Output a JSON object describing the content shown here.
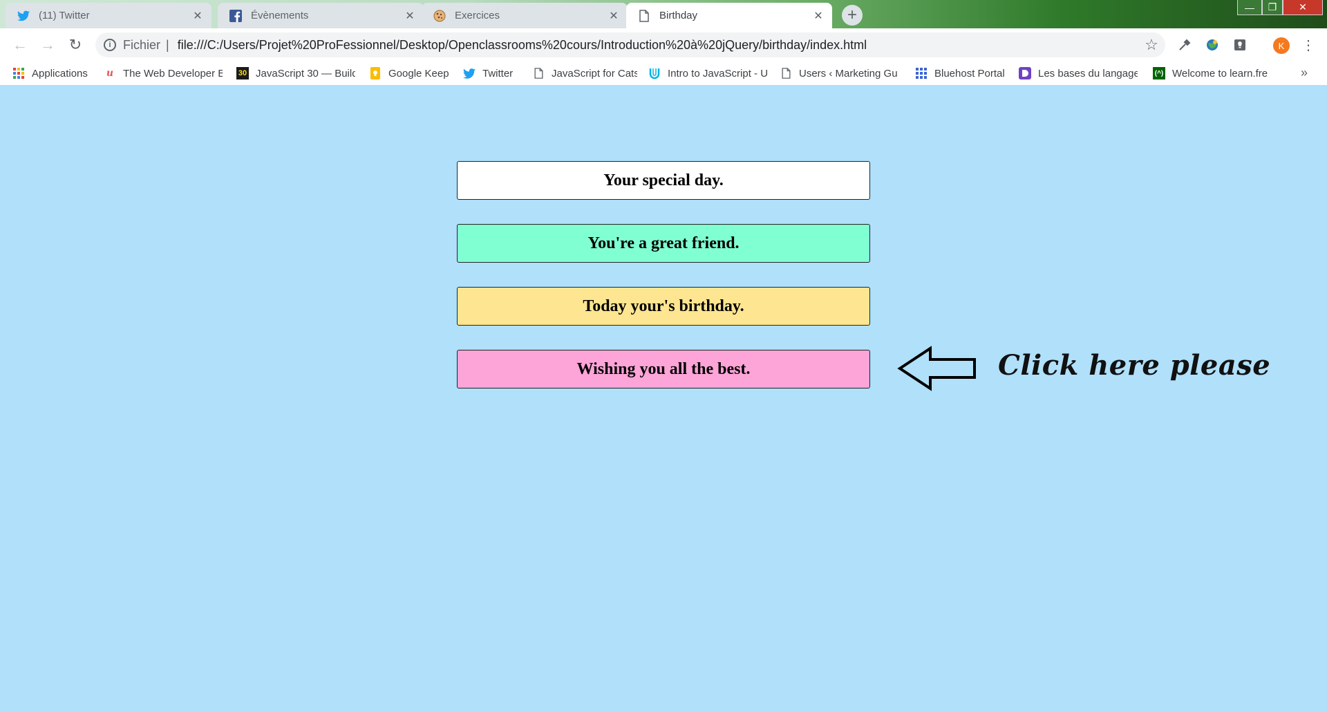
{
  "browser": {
    "tabs": [
      {
        "title": "(11) Twitter",
        "icon": "twitter-icon",
        "active": false
      },
      {
        "title": "Évènements",
        "icon": "facebook-icon",
        "active": false
      },
      {
        "title": "Exercices",
        "icon": "cookie-icon",
        "active": false
      },
      {
        "title": "Birthday",
        "icon": "page-icon",
        "active": true
      }
    ],
    "new_tab_label": "+",
    "window_controls": {
      "minimize": "—",
      "restore": "❐",
      "close": "✕"
    }
  },
  "toolbar": {
    "back": "←",
    "forward": "→",
    "reload": "↻",
    "scheme_label": "Fichier",
    "separator": "|",
    "url": "file:///C:/Users/Projet%20ProFessionnel/Desktop/Openclassrooms%20cours/Introduction%20à%20jQuery/birthday/index.html",
    "star": "☆",
    "avatar_letter": "K",
    "menu": "⋮"
  },
  "bookmarks": [
    {
      "label": "Applications",
      "icon": "apps-grid-icon",
      "color": "#ea4335"
    },
    {
      "label": "The Web Developer B",
      "icon": "udemy-icon",
      "color": "#ec5252"
    },
    {
      "label": "JavaScript 30 — Build",
      "icon": "js30-icon",
      "color": "#f7df1e"
    },
    {
      "label": "Google Keep",
      "icon": "keep-icon",
      "color": "#fbbc04"
    },
    {
      "label": "Twitter",
      "icon": "twitter-icon",
      "color": "#1da1f2"
    },
    {
      "label": "JavaScript for Cats",
      "icon": "page-icon",
      "color": "#5f6368"
    },
    {
      "label": "Intro to JavaScript - U",
      "icon": "udacity-icon",
      "color": "#02b3e4"
    },
    {
      "label": "Users ‹ Marketing Gu",
      "icon": "page-icon",
      "color": "#5f6368"
    },
    {
      "label": "Bluehost Portal",
      "icon": "bluehost-grid-icon",
      "color": "#3b63d3"
    },
    {
      "label": "Les bases du langage",
      "icon": "dev-icon",
      "color": "#6f42c1"
    },
    {
      "label": "Welcome to learn.fre",
      "icon": "freecodecamp-icon",
      "color": "#006400"
    }
  ],
  "bookmarks_more": "»",
  "page": {
    "cards": [
      {
        "text": "Your special day.",
        "color": "#ffffff"
      },
      {
        "text": "You're a great friend.",
        "color": "#80ffd2"
      },
      {
        "text": "Today your's birthday.",
        "color": "#fde591"
      },
      {
        "text": "Wishing you all the best.",
        "color": "#fda4d8"
      }
    ],
    "cta_text": "Click here please",
    "background": "#b0e0fa"
  }
}
